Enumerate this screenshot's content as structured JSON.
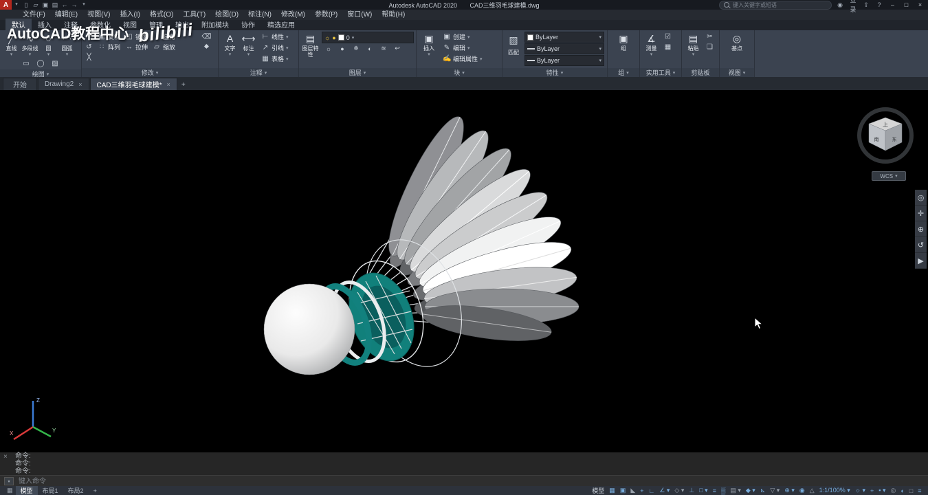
{
  "ui": {
    "caret": "▾",
    "close": "×",
    "minimize": "–",
    "maximize": "□",
    "add": "+"
  },
  "title_bar": {
    "logo": "A",
    "app": "Autodesk AutoCAD 2020",
    "doc": "CAD三维羽毛球建模.dwg",
    "search_placeholder": "键入关键字或短语",
    "signin": "登录",
    "help": "?"
  },
  "watermark": {
    "text": "AutoCAD教程中心",
    "logo": "bilibili"
  },
  "menu": {
    "items": [
      "文件(F)",
      "编辑(E)",
      "视图(V)",
      "插入(I)",
      "格式(O)",
      "工具(T)",
      "绘图(D)",
      "标注(N)",
      "修改(M)",
      "参数(P)",
      "窗口(W)",
      "帮助(H)"
    ]
  },
  "ribbon": {
    "tabs": [
      "默认",
      "插入",
      "注释",
      "参数化",
      "视图",
      "管理",
      "输出",
      "附加模块",
      "协作",
      "精选应用"
    ],
    "panels": {
      "draw": {
        "title": "绘图",
        "big": [
          {
            "name": "line-button",
            "glyph": "╱",
            "label": "直线"
          },
          {
            "name": "polyline-button",
            "glyph": "∿",
            "label": "多段线"
          },
          {
            "name": "circle-button",
            "glyph": "○",
            "label": "圆"
          },
          {
            "name": "arc-button",
            "glyph": "◠",
            "label": "圆弧"
          }
        ],
        "small": [
          {
            "name": "rectangle-icon",
            "glyph": "▭"
          },
          {
            "name": "ellipse-icon",
            "glyph": "◯"
          },
          {
            "name": "hatch-icon",
            "glyph": "▨"
          }
        ]
      },
      "modify": {
        "title": "修改",
        "side": [
          {
            "name": "move-button",
            "glyph": "✛"
          },
          {
            "name": "rotate-button",
            "glyph": "↺"
          },
          {
            "name": "trim-button",
            "glyph": "╳"
          }
        ],
        "buttons": [
          {
            "name": "copy-button",
            "glyph": "▣",
            "label": "复制"
          },
          {
            "name": "mirror-button",
            "glyph": "◫",
            "label": "镜像"
          },
          {
            "name": "fillet-button",
            "glyph": "◞",
            "label": "圆角"
          },
          {
            "name": "array-button",
            "glyph": "∷",
            "label": "阵列"
          },
          {
            "name": "stretch-button",
            "glyph": "↔",
            "label": "拉伸"
          },
          {
            "name": "scale-button",
            "glyph": "▱",
            "label": "缩放"
          }
        ],
        "extra": [
          {
            "name": "erase-icon",
            "glyph": "⌫"
          },
          {
            "name": "explode-icon",
            "glyph": "✸"
          }
        ]
      },
      "annotation": {
        "title": "注释",
        "big": [
          {
            "name": "text-button",
            "glyph": "A",
            "label": "文字"
          },
          {
            "name": "dimension-button",
            "glyph": "⟷",
            "label": "标注"
          }
        ],
        "small": [
          {
            "name": "linear-dimension-button",
            "glyph": "⊢",
            "label": "线性"
          },
          {
            "name": "leader-button",
            "glyph": "↗",
            "label": "引线"
          },
          {
            "name": "table-button",
            "glyph": "▦",
            "label": "表格"
          }
        ]
      },
      "layers": {
        "title": "图层",
        "big": {
          "label": "图层特性",
          "name": "layer-properties-button"
        },
        "combo": {
          "value": "0"
        },
        "grid": [
          {
            "name": "layer-off-icon",
            "glyph": "☼"
          },
          {
            "name": "layer-isolate-icon",
            "glyph": "●"
          },
          {
            "name": "layer-freeze-icon",
            "glyph": "❄"
          },
          {
            "name": "layer-lock-icon",
            "glyph": "◐"
          },
          {
            "name": "layer-match-icon",
            "glyph": "≋"
          },
          {
            "name": "layer-prev-icon",
            "glyph": "↩"
          }
        ]
      },
      "block": {
        "title": "块",
        "big": {
          "label": "插入",
          "name": "insert-block-button"
        },
        "small": [
          {
            "name": "create-block-button",
            "glyph": "▣",
            "label": "创建"
          },
          {
            "name": "edit-block-button",
            "glyph": "✎",
            "label": "编辑"
          },
          {
            "name": "edit-attributes-button",
            "glyph": "✍",
            "label": "编辑属性"
          }
        ]
      },
      "properties": {
        "title": "特性",
        "big": {
          "name": "match-properties-button"
        },
        "combos": [
          {
            "name": "object-color-select",
            "value": "ByLayer"
          },
          {
            "name": "lineweight-select",
            "value": "ByLayer"
          },
          {
            "name": "linetype-select",
            "value": "ByLayer"
          }
        ],
        "match_label": "匹配"
      },
      "group": {
        "title": "组",
        "big": {
          "label": "组",
          "name": "group-button"
        }
      },
      "utilities": {
        "title": "实用工具",
        "big": {
          "label": "测量",
          "name": "measure-button"
        },
        "small": [
          {
            "name": "quick-select-icon",
            "glyph": "☑"
          },
          {
            "name": "quick-calc-icon",
            "glyph": "▦"
          }
        ]
      },
      "clipboard": {
        "title": "剪贴板",
        "big": {
          "label": "粘贴",
          "name": "paste-button"
        },
        "small": [
          {
            "name": "cut-icon",
            "glyph": "✂"
          },
          {
            "name": "copy-clip-icon",
            "glyph": "❏"
          }
        ]
      },
      "view": {
        "title": "视图",
        "big": {
          "label": "基点",
          "name": "base-point-button"
        }
      }
    }
  },
  "file_tabs": {
    "start": "开始",
    "tab2": "Drawing2",
    "tab3": "CAD三维羽毛球建模*"
  },
  "viewport": {
    "viewcube": {
      "top": "上",
      "left_face": "南",
      "right_face": "东",
      "wcs": "WCS"
    },
    "ucs": {
      "x": "X",
      "y": "Y",
      "z": "Z"
    }
  },
  "command": {
    "lines": [
      "命令:",
      "命令:",
      "命令:"
    ],
    "placeholder": "键入命令"
  },
  "status": {
    "tabs": [
      "模型",
      "布局1",
      "布局2"
    ],
    "controls": [
      {
        "name": "model-space-button",
        "label": "模型"
      },
      {
        "name": "grid-icon",
        "label": "▦"
      },
      {
        "name": "snap-icon",
        "label": "▣"
      },
      {
        "name": "infer-constraints-icon",
        "label": "◣"
      },
      {
        "name": "dynamic-input-icon",
        "label": "+"
      },
      {
        "name": "ortho-icon",
        "label": "∟"
      },
      {
        "name": "polar-tracking-icon",
        "label": "∠ ▾"
      },
      {
        "name": "isodraft-icon",
        "label": "◇ ▾"
      },
      {
        "name": "osnap-tracking-icon",
        "label": "⊥"
      },
      {
        "name": "osnap-icon",
        "label": "□ ▾"
      },
      {
        "name": "lineweight-icon",
        "label": "≡"
      },
      {
        "name": "transparency-icon",
        "label": "▒"
      },
      {
        "name": "selection-cycling-icon",
        "label": "▤ ▾"
      },
      {
        "name": "3d-osnap-icon",
        "label": "◆ ▾"
      },
      {
        "name": "dynamic-ucs-icon",
        "label": "⊾"
      },
      {
        "name": "selection-filter-icon",
        "label": "▽ ▾"
      },
      {
        "name": "gizmo-icon",
        "label": "⊕ ▾"
      },
      {
        "name": "annotation-visibility-icon",
        "label": "◉"
      },
      {
        "name": "autoscale-icon",
        "label": "△"
      },
      {
        "name": "annotation-scale-button",
        "label": "1:1/100% ▾"
      },
      {
        "name": "workspace-switching-icon",
        "label": "☼ ▾"
      },
      {
        "name": "annotation-monitor-icon",
        "label": "+"
      },
      {
        "name": "ui-lock-icon",
        "label": "▪ ▾"
      },
      {
        "name": "isolate-objects-icon",
        "label": "◎"
      },
      {
        "name": "graphics-performance-icon",
        "label": "◐"
      },
      {
        "name": "clean-screen-icon",
        "label": "□"
      },
      {
        "name": "customize-icon",
        "label": "≡"
      }
    ]
  }
}
